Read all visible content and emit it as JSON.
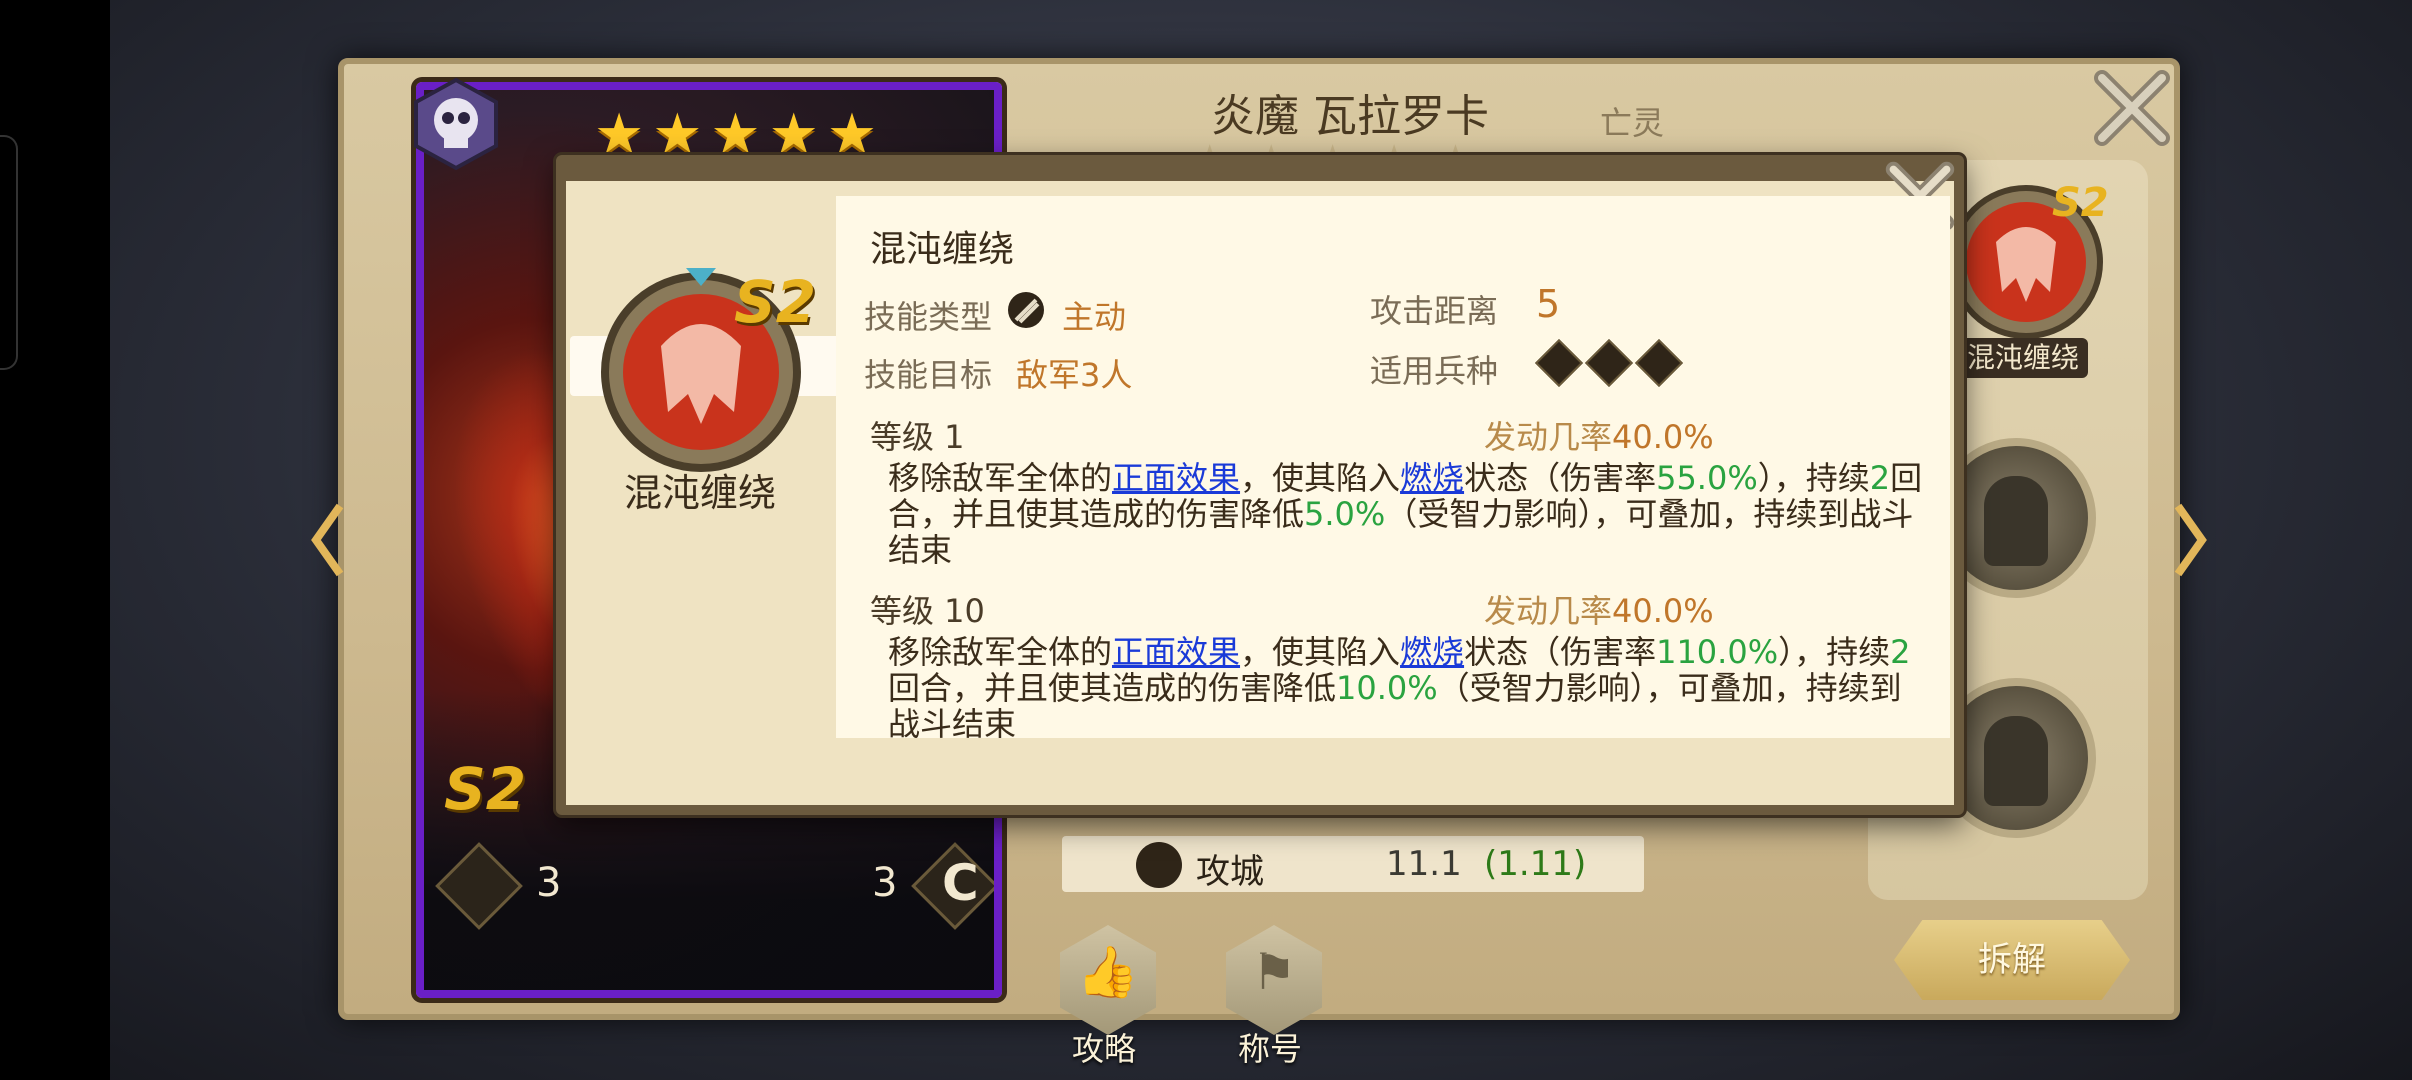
{
  "hero": {
    "title": "炎魔 瓦拉罗卡",
    "faction": "亡灵",
    "card_name": "炎魔",
    "card_stars": "★★★★★",
    "title_stars": "★★★★★",
    "skill_tag": "S2",
    "left_num": "3",
    "right_num": "3",
    "right_glyph": "C"
  },
  "stat": {
    "label": "攻城",
    "value": "11.1",
    "growth": "(1.11)"
  },
  "bottom_buttons": {
    "guide": "攻略",
    "title": "称号"
  },
  "side": {
    "skill_label": "混沌缠绕",
    "skill_tag": "S2",
    "disassemble": "拆解"
  },
  "modal": {
    "badge_name": "混沌缠绕",
    "badge_tag": "S2",
    "skill_name": "混沌缠绕",
    "skill_type_label": "技能类型",
    "skill_type_value": "主动",
    "range_label": "攻击距离",
    "range_value": "5",
    "target_label": "技能目标",
    "target_value": "敌军3人",
    "troops_label": "适用兵种",
    "levels": [
      {
        "level": "等级 1",
        "rate_label": "发动几率",
        "rate": "40.0%",
        "d1": "移除敌军全体的",
        "l1": "正面效果",
        "d2": "，使其陷入",
        "l2": "燃烧",
        "d3": "状态（伤害率",
        "n1": "55.0%",
        "d4": "），持续",
        "n2": "2",
        "d5": "回合，并且使其造成的伤害降低",
        "n3": "5.0%",
        "d6": "（受智力影响），可叠加，持续到战斗结束"
      },
      {
        "level": "等级 10",
        "rate_label": "发动几率",
        "rate": "40.0%",
        "d1": "移除敌军全体的",
        "l1": "正面效果",
        "d2": "，使其陷入",
        "l2": "燃烧",
        "d3": "状态（伤害率",
        "n1": "110.0%",
        "d4": "），持续",
        "n2": "2",
        "d5": "回合，并且使其造成的伤害降低",
        "n3": "10.0%",
        "d6": "（受智力影响），可叠加，持续到战斗结束"
      }
    ]
  },
  "colors": {
    "link": "#1a3ad8",
    "highlight": "#2aa340",
    "card_border": "#6a1fc7",
    "accent": "#c0762a"
  },
  "icons": [
    "skull-badge-icon",
    "close-icon",
    "arrow-left-icon",
    "arrow-right-icon",
    "bow-icon",
    "shield-c-icon",
    "thumbs-up-icon",
    "flag-icon",
    "active-skill-icon",
    "demon-mask-icon"
  ]
}
